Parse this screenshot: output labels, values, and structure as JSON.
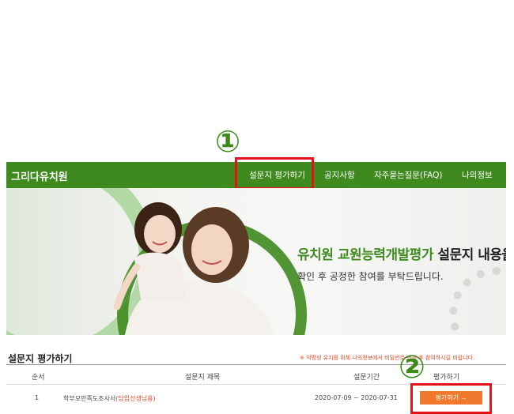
{
  "step_markers": {
    "first": "①",
    "second": "②"
  },
  "nav": {
    "brand": "그리다유치원",
    "items": [
      "설문지 평가하기",
      "공지사항",
      "자주묻는질문(FAQ)",
      "나의정보"
    ]
  },
  "banner": {
    "highlight": "유치원 교원능력개발평가",
    "tail": " 설문지 내용을",
    "subline": "확인 후 공정한 참여를 부탁드립니다."
  },
  "section": {
    "title": "설문지 평가하기",
    "notice": "※ 익명성 유지를 위해 나의정보에서 비밀번호 변경 후 참여하시길 바랍니다."
  },
  "table": {
    "headers": [
      "순서",
      "설문지 제목",
      "설문기간",
      "평가하기"
    ],
    "rows": [
      {
        "no": "1",
        "title": "학부모만족도조사서",
        "target": "(담임선생님용)",
        "period": "2020-07-09 ~ 2020-07-31",
        "action": "평가하기 →"
      }
    ]
  },
  "colors": {
    "brand_green": "#3f8a1f",
    "accent_orange": "#f0792d",
    "highlight_red": "#e5121a"
  }
}
